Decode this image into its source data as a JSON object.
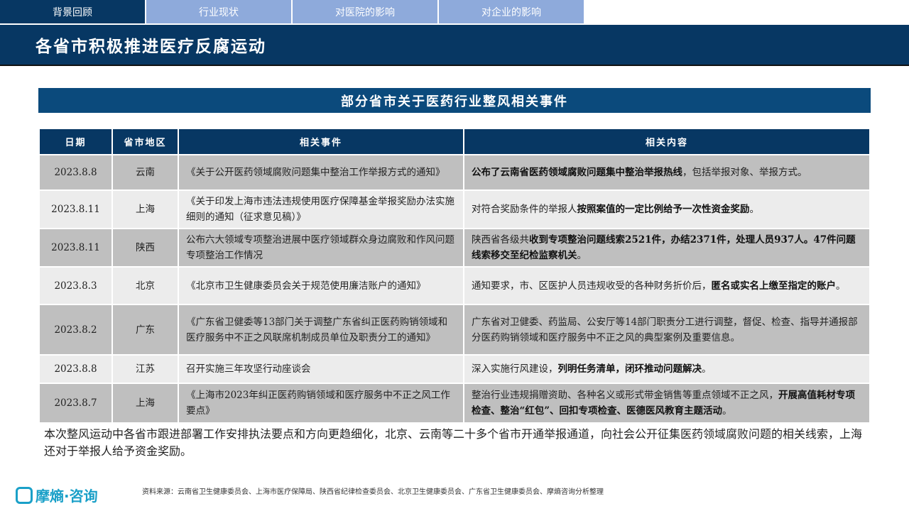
{
  "tabs": [
    "背景回顾",
    "行业现状",
    "对医院的影响",
    "对企业的影响"
  ],
  "title": "各省市积极推进医疗反腐运动",
  "subtitle": "部分省市关于医药行业整风相关事件",
  "headers": [
    "日期",
    "省市地区",
    "相关事件",
    "相关内容"
  ],
  "rows": [
    {
      "date": "2023.8.8",
      "region": "云南",
      "event": "《关于公开医药领域腐败问题集中整治工作举报方式的通知》",
      "content": [
        {
          "t": "公布了云南省医药领域腐败问题集中整治举报热线",
          "b": true
        },
        {
          "t": "，包括举报对象、举报方式。",
          "b": false
        }
      ]
    },
    {
      "date": "2023.8.11",
      "region": "上海",
      "event": "《关于印发上海市违法违规使用医疗保障基金举报奖励办法实施细则的通知（征求意见稿）》",
      "content": [
        {
          "t": "对符合奖励条件的举报人",
          "b": false
        },
        {
          "t": "按照案值的一定比例给予一次性资金奖励",
          "b": true
        },
        {
          "t": "。",
          "b": false
        }
      ]
    },
    {
      "date": "2023.8.11",
      "region": "陕西",
      "event": "公布六大领域专项整治进展中医疗领域群众身边腐败和作风问题专项整治工作情况",
      "content": [
        {
          "t": "陕西省各级共",
          "b": false
        },
        {
          "t": "收到专项整治问题线索2521件，办结2371件，处理人员937人。47件问题线索移交至纪检监察机关",
          "b": true
        },
        {
          "t": "。",
          "b": false
        }
      ]
    },
    {
      "date": "2023.8.3",
      "region": "北京",
      "event": "《北京市卫生健康委员会关于规范使用廉洁账户的通知》",
      "content": [
        {
          "t": "通知要求，市、区医护人员违规收受的各种财务折价后，",
          "b": false
        },
        {
          "t": "匿名或实名上缴至指定的账户",
          "b": true
        },
        {
          "t": "。",
          "b": false
        }
      ]
    },
    {
      "date": "2023.8.2",
      "region": "广东",
      "event": "《广东省卫健委等13部门关于调整广东省纠正医药购销领域和医疗服务中不正之风联席机制成员单位及职责分工的通知》",
      "content": [
        {
          "t": "广东省对卫健委、药监局、公安厅等14部门职责分工进行调整，督促、检查、指导并通报部分医药购销领域和医疗服务中不正之风的典型案例及重要信息。",
          "b": false
        }
      ]
    },
    {
      "date": "2023.8.8",
      "region": "江苏",
      "event": "召开实施三年攻坚行动座谈会",
      "content": [
        {
          "t": "深入实施行风建设，",
          "b": false
        },
        {
          "t": "列明任务清单，闭环推动问题解决",
          "b": true
        },
        {
          "t": "。",
          "b": false
        }
      ]
    },
    {
      "date": "2023.8.7",
      "region": "上海",
      "event": "《上海市2023年纠正医药购销领域和医疗服务中不正之风工作要点》",
      "content": [
        {
          "t": "整治行业违规捐赠资助、各种名义或形式带金销售等重点领域不正之风，",
          "b": false
        },
        {
          "t": "开展高值耗材专项检查、整治“红包”、回扣专项检查、医德医风教育主题活动",
          "b": true
        },
        {
          "t": "。",
          "b": false
        }
      ]
    }
  ],
  "summary": "本次整风运动中各省市跟进部署工作安排执法要点和方向更趋细化，北京、云南等二十多个省市开通举报通道，向社会公开征集医药领域腐败问题的相关线索，上海还对于举报人给予资金奖励。",
  "logo": "摩熵·咨询",
  "source": "资料来源：云南省卫生健康委员会、上海市医疗保障局、陕西省纪律检查委员会、北京卫生健康委员会、广东省卫生健康委员会、摩熵咨询分析整理"
}
